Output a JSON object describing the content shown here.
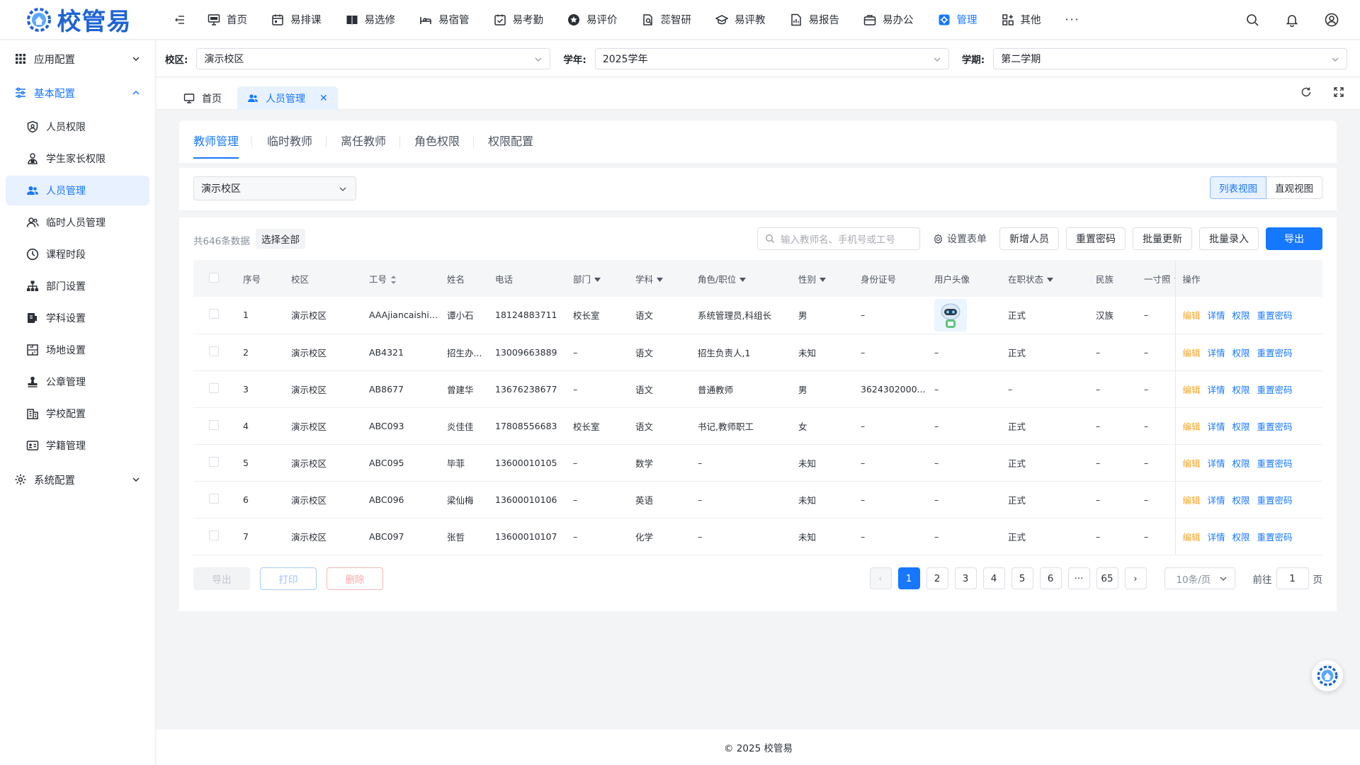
{
  "app": {
    "logo_text": "校管易",
    "brand_color": "#1677ff"
  },
  "topnav": [
    {
      "label": "首页",
      "icon": "monitor-icon"
    },
    {
      "label": "易排课",
      "icon": "calendar-icon"
    },
    {
      "label": "易选修",
      "icon": "book-icon"
    },
    {
      "label": "易宿管",
      "icon": "bed-icon"
    },
    {
      "label": "易考勤",
      "icon": "calendar-check-icon"
    },
    {
      "label": "易评价",
      "icon": "star-icon"
    },
    {
      "label": "蕊智研",
      "icon": "research-icon"
    },
    {
      "label": "易评教",
      "icon": "graduation-cap-icon"
    },
    {
      "label": "易报告",
      "icon": "report-icon"
    },
    {
      "label": "易办公",
      "icon": "briefcase-icon"
    },
    {
      "label": "管理",
      "icon": "gear-icon",
      "active": true
    },
    {
      "label": "其他",
      "icon": "apps-icon"
    },
    {
      "label": "···",
      "icon": ""
    }
  ],
  "sidebar": {
    "groups": [
      {
        "label": "应用配置",
        "icon": "grid-icon",
        "expanded": false
      },
      {
        "label": "基本配置",
        "icon": "sliders-icon",
        "expanded": true
      },
      {
        "label": "系统配置",
        "icon": "settings-icon",
        "expanded": false
      }
    ],
    "items": [
      {
        "label": "人员权限",
        "icon": "user-shield-icon"
      },
      {
        "label": "学生家长权限",
        "icon": "user-lock-icon"
      },
      {
        "label": "人员管理",
        "icon": "users-icon",
        "active": true
      },
      {
        "label": "临时人员管理",
        "icon": "user-temp-icon"
      },
      {
        "label": "课程时段",
        "icon": "clock-icon"
      },
      {
        "label": "部门设置",
        "icon": "org-chart-icon"
      },
      {
        "label": "学科设置",
        "icon": "subject-icon"
      },
      {
        "label": "场地设置",
        "icon": "venue-icon"
      },
      {
        "label": "公章管理",
        "icon": "stamp-icon"
      },
      {
        "label": "学校配置",
        "icon": "building-icon"
      },
      {
        "label": "学籍管理",
        "icon": "id-card-icon"
      }
    ]
  },
  "filterbar": {
    "campus_label": "校区:",
    "campus_value": "演示校区",
    "year_label": "学年:",
    "year_value": "2025学年",
    "term_label": "学期:",
    "term_value": "第二学期"
  },
  "page_tabs": [
    {
      "label": "首页",
      "active": false
    },
    {
      "label": "人员管理",
      "active": true
    }
  ],
  "subtabs": [
    "教师管理",
    "临时教师",
    "离任教师",
    "角色权限",
    "权限配置"
  ],
  "campus_filter": "演示校区",
  "views": {
    "list": "列表视图",
    "visual": "直观视图"
  },
  "toolbar": {
    "count": "共646条数据",
    "select_all": "选择全部",
    "search_placeholder": "输入教师名、手机号或工号",
    "settings": "设置表单",
    "add": "新增人员",
    "reset_pwd": "重置密码",
    "batch_update": "批量更新",
    "batch_import": "批量录入",
    "export": "导出"
  },
  "table": {
    "columns": [
      "序号",
      "校区",
      "工号",
      "姓名",
      "电话",
      "部门",
      "学科",
      "角色/职位",
      "性别",
      "身份证号",
      "用户头像",
      "在职状态",
      "民族",
      "一寸照",
      "操作"
    ],
    "rows": [
      {
        "no": "1",
        "campus": "演示校区",
        "id": "AAAjiancaishiz...",
        "name": "谭小石",
        "phone": "18124883711",
        "dept": "校长室",
        "subject": "语文",
        "role": "系统管理员,科组长",
        "gender": "男",
        "idcard": "–",
        "avatar": true,
        "status": "正式",
        "nation": "汉族",
        "photo": "–"
      },
      {
        "no": "2",
        "campus": "演示校区",
        "id": "AB4321",
        "name": "招生办...",
        "phone": "13009663889",
        "dept": "–",
        "subject": "语文",
        "role": "招生负责人,1",
        "gender": "未知",
        "idcard": "–",
        "avatar": false,
        "status": "正式",
        "nation": "–",
        "photo": "–"
      },
      {
        "no": "3",
        "campus": "演示校区",
        "id": "AB8677",
        "name": "曾建华",
        "phone": "13676238677",
        "dept": "–",
        "subject": "语文",
        "role": "普通教师",
        "gender": "男",
        "idcard": "3624302000...",
        "avatar": false,
        "status": "–",
        "nation": "–",
        "photo": "–"
      },
      {
        "no": "4",
        "campus": "演示校区",
        "id": "ABC093",
        "name": "炎佳佳",
        "phone": "17808556683",
        "dept": "校长室",
        "subject": "语文",
        "role": "书记,教师职工",
        "gender": "女",
        "idcard": "–",
        "avatar": false,
        "status": "正式",
        "nation": "–",
        "photo": "–"
      },
      {
        "no": "5",
        "campus": "演示校区",
        "id": "ABC095",
        "name": "毕菲",
        "phone": "13600010105",
        "dept": "–",
        "subject": "数学",
        "role": "–",
        "gender": "未知",
        "idcard": "–",
        "avatar": false,
        "status": "正式",
        "nation": "–",
        "photo": "–"
      },
      {
        "no": "6",
        "campus": "演示校区",
        "id": "ABC096",
        "name": "梁仙梅",
        "phone": "13600010106",
        "dept": "–",
        "subject": "英语",
        "role": "–",
        "gender": "未知",
        "idcard": "–",
        "avatar": false,
        "status": "正式",
        "nation": "–",
        "photo": "–"
      },
      {
        "no": "7",
        "campus": "演示校区",
        "id": "ABC097",
        "name": "张哲",
        "phone": "13600010107",
        "dept": "–",
        "subject": "化学",
        "role": "–",
        "gender": "未知",
        "idcard": "–",
        "avatar": false,
        "status": "正式",
        "nation": "–",
        "photo": "–"
      }
    ],
    "ops": [
      "编辑",
      "详情",
      "权限",
      "重置密码"
    ]
  },
  "footer": {
    "export": "导出",
    "print": "打印",
    "delete": "删除",
    "pages": [
      "1",
      "2",
      "3",
      "4",
      "5",
      "6",
      "···",
      "65"
    ],
    "current_page": "1",
    "page_size": "10条/页",
    "goto_prefix": "前往",
    "goto_value": "1",
    "goto_suffix": "页"
  },
  "copyright": "© 2025 校管易"
}
